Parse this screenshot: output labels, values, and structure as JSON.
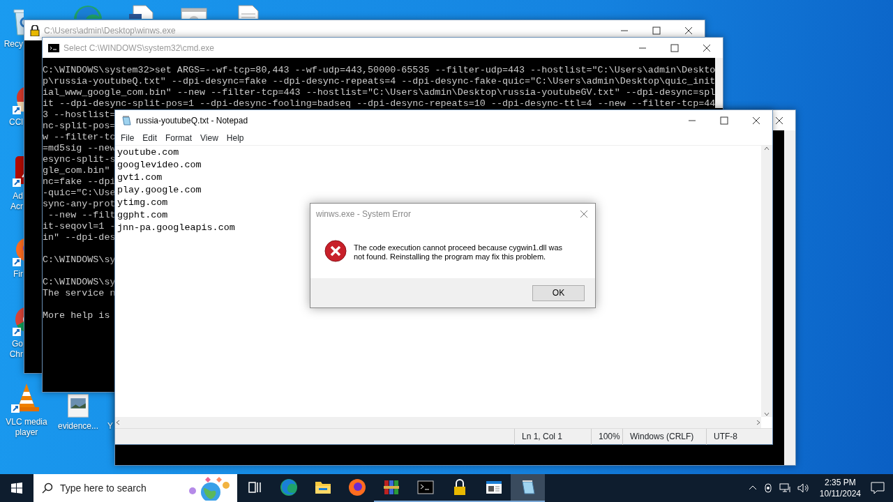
{
  "desktop_icons": [
    {
      "kind": "recycle-bin",
      "label": "Recy"
    },
    {
      "kind": "edge"
    },
    {
      "kind": "word-doc"
    },
    {
      "kind": "settings-window"
    },
    {
      "kind": "text-file"
    },
    {
      "kind": "ccleaner",
      "label": "CCl"
    },
    {
      "kind": "acrobat",
      "label": "Ad\nAcr"
    },
    {
      "kind": "firefox",
      "label": "Fir"
    },
    {
      "kind": "chrome",
      "label": "Go\nChr"
    },
    {
      "kind": "vlc",
      "label": "VLC media player"
    },
    {
      "kind": "image-file",
      "label": "evidence..."
    },
    {
      "kind": "blank",
      "label": "Y"
    }
  ],
  "winws_window": {
    "title": "C:\\Users\\admin\\Desktop\\winws.exe",
    "active": false
  },
  "cmd_window": {
    "title": "Select C:\\WINDOWS\\system32\\cmd.exe",
    "active": false,
    "blocks": [
      [
        "C:\\WINDOWS\\system32>set ARGS=--wf-tcp=80,443 --wf-udp=443,50000-65535 --filter-udp=443 --hostlist=\"C:\\Users\\admin\\Deskto",
        "p\\russia-youtubeQ.txt\" --dpi-desync=fake --dpi-desync-repeats=4 --dpi-desync-fake-quic=\"C:\\Users\\admin\\Desktop\\quic_init",
        "ial_www_google_com.bin\" --new --filter-tcp=443 --hostlist=\"C:\\Users\\admin\\Desktop\\russia-youtubeGV.txt\" --dpi-desync=spl",
        "it --dpi-desync-split-pos=1 --dpi-desync-fooling=badseq --dpi-desync-repeats=10 --dpi-desync-ttl=4 --new --filter-tcp=44",
        "3 --hostlist=",
        "nc-split-pos=",
        "w --filter-tc",
        "=md5sig --new",
        "esync-split-s",
        "gle_com.bin\"",
        "nc=fake --dpi",
        "-quic=\"C:\\Use",
        "sync-any-prot",
        " --new --filt",
        "it-seqovl=1 -",
        "in\" --dpi-des"
      ],
      [
        "C:\\WINDOWS\\sy"
      ],
      [
        "C:\\WINDOWS\\sy",
        "The service n"
      ],
      [
        "More help is"
      ]
    ]
  },
  "notepad": {
    "title": "russia-youtubeQ.txt - Notepad",
    "active": true,
    "menu": [
      "File",
      "Edit",
      "Format",
      "View",
      "Help"
    ],
    "lines": [
      "youtube.com",
      "googlevideo.com",
      "gvt1.com",
      "play.google.com",
      "ytimg.com",
      "ggpht.com",
      "jnn-pa.googleapis.com"
    ],
    "status": [
      "Ln 1, Col 1",
      "100%",
      "Windows (CRLF)",
      "UTF-8"
    ]
  },
  "dialog": {
    "title": "winws.exe - System Error",
    "message": "The code execution cannot proceed because cygwin1.dll was not found. Reinstalling the program may fix this problem.",
    "button": "OK"
  },
  "taskbar": {
    "search_placeholder": "Type here to search",
    "apps": [
      {
        "kind": "task-view",
        "running": false,
        "active": false
      },
      {
        "kind": "edge",
        "running": false,
        "active": false
      },
      {
        "kind": "folder",
        "running": false,
        "active": false
      },
      {
        "kind": "firefox",
        "running": false,
        "active": false
      },
      {
        "kind": "winrar",
        "running": true,
        "active": false
      },
      {
        "kind": "terminal",
        "running": true,
        "active": false
      },
      {
        "kind": "lock",
        "running": true,
        "active": false
      },
      {
        "kind": "window-app",
        "running": true,
        "active": false
      },
      {
        "kind": "notepad",
        "running": true,
        "active": true
      }
    ],
    "time": "2:35 PM",
    "date": "10/11/2024"
  }
}
